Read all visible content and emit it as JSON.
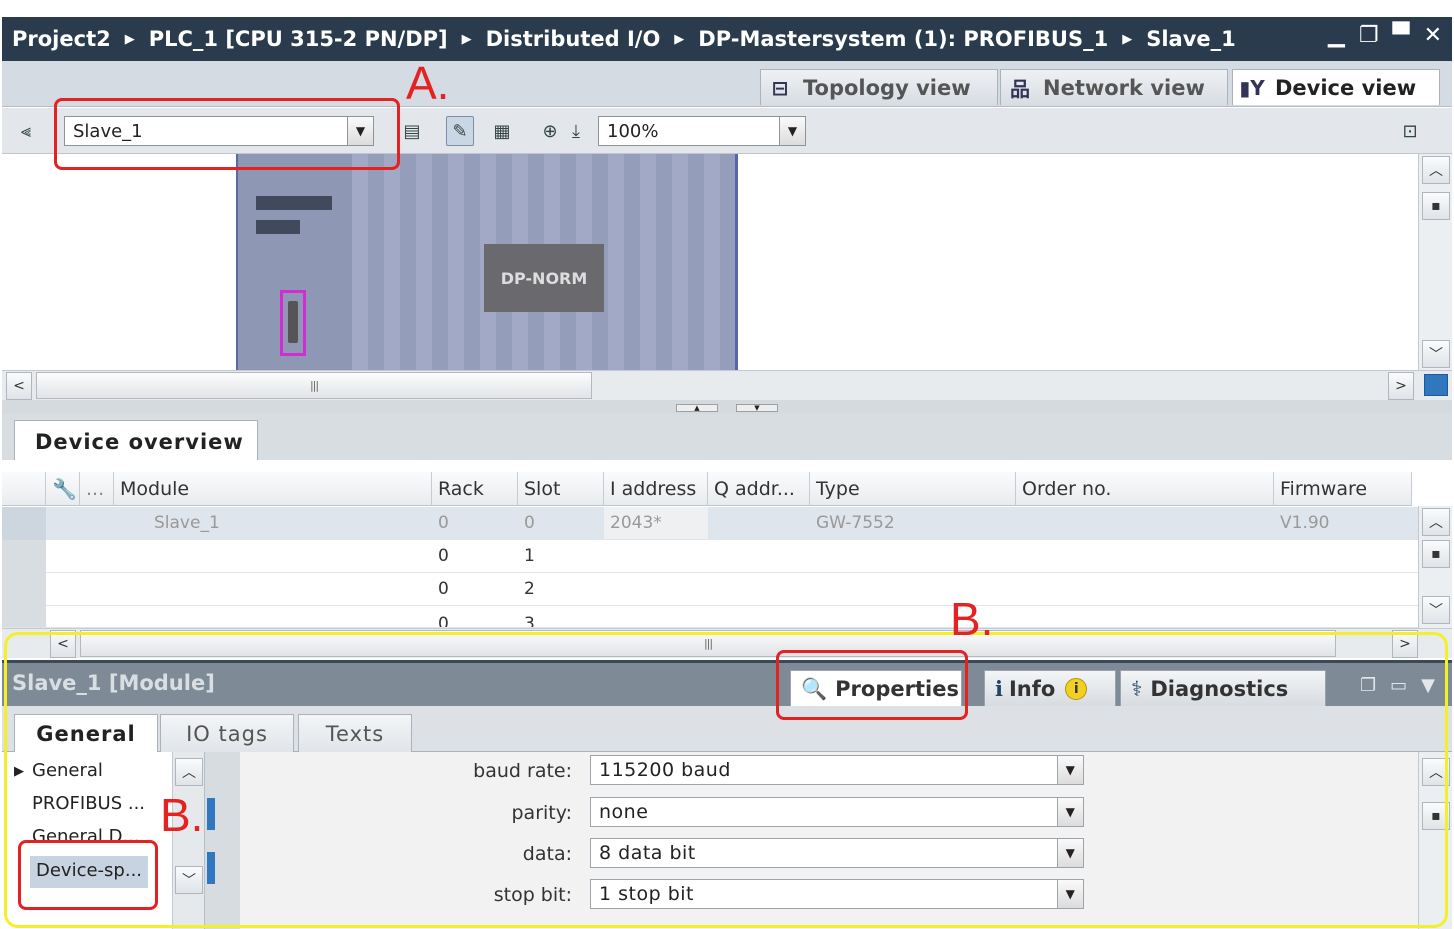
{
  "breadcrumb": [
    "Project2",
    "PLC_1 [CPU 315-2 PN/DP]",
    "Distributed I/O",
    "DP-Mastersystem (1): PROFIBUS_1",
    "Slave_1"
  ],
  "view_tabs": {
    "topology": "Topology view",
    "network": "Network view",
    "device": "Device view"
  },
  "toolbar": {
    "device_select": "Slave_1",
    "zoom": "100%"
  },
  "canvas": {
    "module_label": "DP-NORM"
  },
  "overview": {
    "tab": "Device overview",
    "columns": {
      "dots": "...",
      "module": "Module",
      "rack": "Rack",
      "slot": "Slot",
      "iaddr": "I address",
      "qaddr": "Q addr...",
      "type": "Type",
      "order": "Order no.",
      "firmware": "Firmware"
    },
    "rows": [
      {
        "module": "Slave_1",
        "rack": "0",
        "slot": "0",
        "iaddr": "2043*",
        "type": "GW-7552",
        "firmware": "V1.90"
      },
      {
        "module": "",
        "rack": "0",
        "slot": "1",
        "iaddr": "",
        "type": "",
        "firmware": ""
      },
      {
        "module": "",
        "rack": "0",
        "slot": "2",
        "iaddr": "",
        "type": "",
        "firmware": ""
      },
      {
        "module": "",
        "rack": "0",
        "slot": "3",
        "iaddr": "",
        "type": "",
        "firmware": ""
      }
    ]
  },
  "inspector": {
    "title": "Slave_1 [Module]",
    "tabs": {
      "properties": "Properties",
      "info": "Info",
      "diagnostics": "Diagnostics"
    },
    "subtabs": {
      "general": "General",
      "io_tags": "IO tags",
      "texts": "Texts"
    },
    "nav": [
      "General",
      "PROFIBUS ...",
      "General D...",
      "Device-sp..."
    ],
    "fields": [
      {
        "label": "baud rate:",
        "value": "115200 baud"
      },
      {
        "label": "parity:",
        "value": "none"
      },
      {
        "label": "data:",
        "value": "8 data bit"
      },
      {
        "label": "stop bit:",
        "value": "1 stop bit"
      }
    ]
  },
  "annotations": {
    "a": "A.",
    "b1": "B.",
    "b2": "B."
  },
  "colors": {
    "annotation_red": "#e52222",
    "annotation_yellow": "#f3f02a",
    "titlebar": "#2a3b4d",
    "rack": "#9aa3c2",
    "focus_box": "#d42cd4"
  }
}
